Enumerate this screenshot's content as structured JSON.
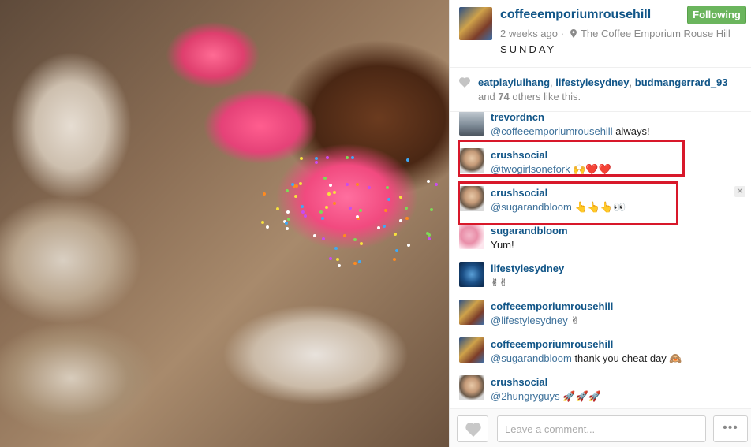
{
  "post": {
    "username": "coffeeemporiumrousehill",
    "time_ago": "2 weeks ago",
    "meta_separator": "·",
    "location": "The Coffee Emporium Rouse Hill",
    "caption": "SUNDAY",
    "follow_label": "Following"
  },
  "likes": {
    "liker1": "eatplayluihang",
    "liker2": "lifestylesydney",
    "liker3": "budmangerrard_93",
    "comma": ",",
    "and_label": "and",
    "others_count": "74",
    "others_suffix": "others like this."
  },
  "comments": [
    {
      "user": "trevordncn",
      "mention": "@coffeeemporiumrousehill",
      "text": " always!"
    },
    {
      "user": "crushsocial",
      "mention": "@twogirlsonefork",
      "text": " 🙌❤️❤️"
    },
    {
      "user": "crushsocial",
      "mention": "@sugarandbloom",
      "text": " 👆👆👆👀"
    },
    {
      "user": "sugarandbloom",
      "mention": "",
      "text": "Yum!"
    },
    {
      "user": "lifestylesydney",
      "mention": "",
      "text": "✌✌"
    },
    {
      "user": "coffeeemporiumrousehill",
      "mention": "@lifestylesydney",
      "text": " ✌"
    },
    {
      "user": "coffeeemporiumrousehill",
      "mention": "@sugarandbloom",
      "text": " thank you cheat day 🙈"
    },
    {
      "user": "crushsocial",
      "mention": "@2hungryguys",
      "text": " 🚀🚀🚀"
    }
  ],
  "close_glyph": "✕",
  "footer": {
    "comment_placeholder": "Leave a comment...",
    "more_label": "•••"
  },
  "colors": {
    "link": "#125688",
    "follow_bg": "#6bb55d",
    "highlight": "#d8182a"
  },
  "icons": [
    "heart-icon",
    "location-pin-icon",
    "close-icon",
    "more-options-icon"
  ]
}
